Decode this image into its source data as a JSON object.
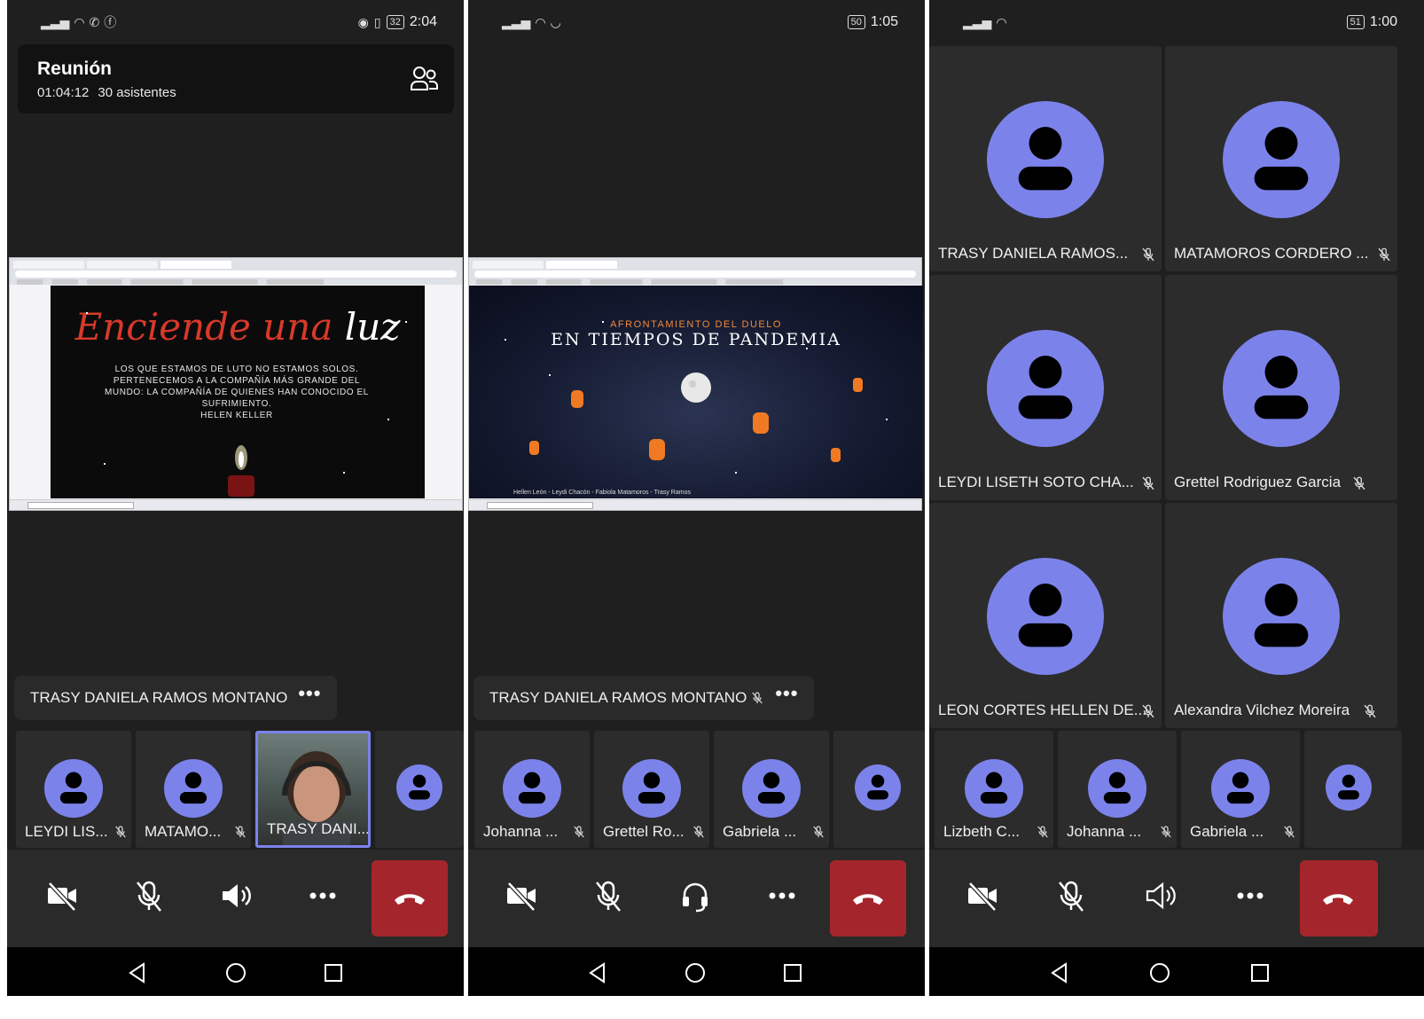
{
  "screens": [
    {
      "status": {
        "clock": "2:04",
        "battery": "32"
      },
      "header": {
        "title": "Reunión",
        "duration": "01:04:12",
        "attendees": "30 asistentes"
      },
      "slide": {
        "title_part1": "Enciende una",
        "title_part2": "luz",
        "quote": "LOS QUE ESTAMOS DE LUTO NO ESTAMOS SOLOS. PERTENECEMOS A LA COMPAÑÍA MÁS GRANDE DEL MUNDO: LA COMPAÑÍA DE QUIENES HAN CONOCIDO EL SUFRIMIENTO.",
        "author": "HELEN KELLER"
      },
      "speaker": {
        "name": "TRASY DANIELA RAMOS MONTANO",
        "more": "•••"
      },
      "tiles": [
        {
          "name": "LEYDI LIS...",
          "muted": true
        },
        {
          "name": "MATAMO...",
          "muted": true
        },
        {
          "name": "TRASY DANI...",
          "muted": false,
          "video": true,
          "active": true
        },
        {
          "name": "",
          "muted": false
        }
      ],
      "controls": {
        "camera": "camera-off",
        "mic": "mic-off",
        "audio": "speaker-on",
        "more": "•••",
        "hangup": "hang-up"
      }
    },
    {
      "status": {
        "clock": "1:05",
        "battery": "50"
      },
      "slide": {
        "subtitle": "AFRONTAMIENTO DEL DUELO",
        "title": "EN TIEMPOS DE PANDEMIA",
        "credits": "Hellen León - Leydi Chacón - Fabiola Matamoros - Trasy Ramos"
      },
      "speaker": {
        "name": "TRASY DANIELA RAMOS MONTANO",
        "more": "•••",
        "muted": true
      },
      "tiles": [
        {
          "name": "Johanna ...",
          "muted": true
        },
        {
          "name": "Grettel Ro...",
          "muted": true
        },
        {
          "name": "Gabriela ...",
          "muted": true
        },
        {
          "name": "",
          "muted": false
        }
      ],
      "controls": {
        "camera": "camera-off",
        "mic": "mic-off",
        "audio": "headset",
        "more": "•••",
        "hangup": "hang-up"
      }
    },
    {
      "status": {
        "clock": "1:00",
        "battery": "51"
      },
      "grid": [
        {
          "name": "TRASY DANIELA RAMOS...",
          "muted": true
        },
        {
          "name": "MATAMOROS CORDERO ...",
          "muted": true
        },
        {
          "name": "LEYDI LISETH SOTO CHA...",
          "muted": true
        },
        {
          "name": "Grettel Rodriguez Garcia",
          "muted": true
        },
        {
          "name": "LEON CORTES HELLEN DE...",
          "muted": true
        },
        {
          "name": "Alexandra Vilchez Moreira",
          "muted": true
        }
      ],
      "tiles": [
        {
          "name": "Lizbeth C...",
          "muted": true
        },
        {
          "name": "Johanna ...",
          "muted": true
        },
        {
          "name": "Gabriela ...",
          "muted": true
        },
        {
          "name": "",
          "muted": false
        }
      ],
      "controls": {
        "camera": "camera-off",
        "mic": "mic-off",
        "audio": "speaker-outline",
        "more": "•••",
        "hangup": "hang-up"
      }
    }
  ],
  "colors": {
    "avatar": "#7b83eb",
    "hangup": "#a4262c",
    "background": "#201f1f",
    "tile": "#2d2c2c"
  }
}
